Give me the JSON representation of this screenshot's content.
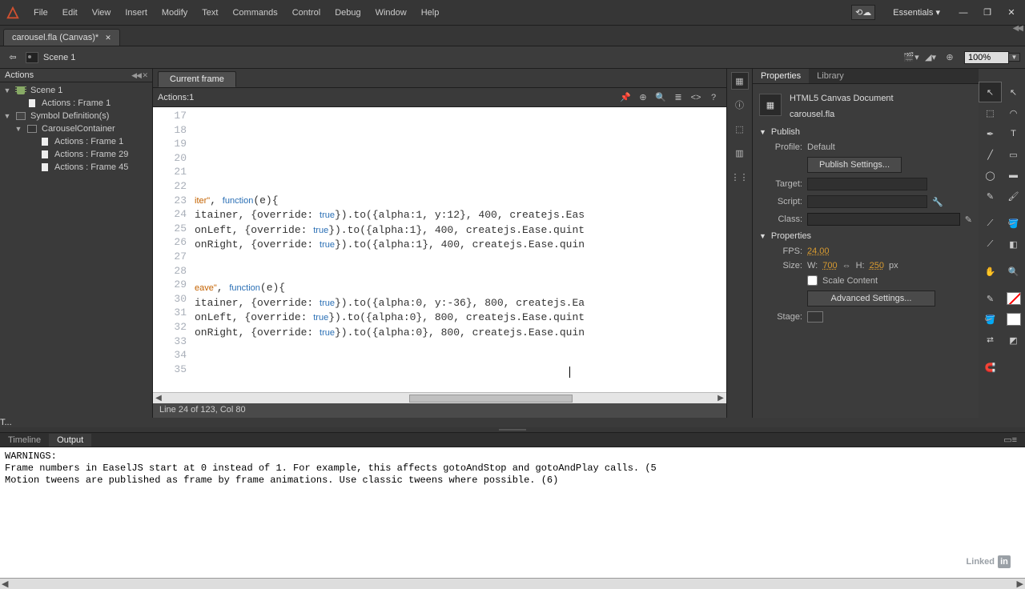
{
  "menu": {
    "items": [
      "File",
      "Edit",
      "View",
      "Insert",
      "Modify",
      "Text",
      "Commands",
      "Control",
      "Debug",
      "Window",
      "Help"
    ],
    "workspace": "Essentials"
  },
  "file_tab": {
    "name": "carousel.fla (Canvas)*"
  },
  "doc": {
    "scene": "Scene 1",
    "zoom": "100%"
  },
  "actions": {
    "panel": "Actions",
    "tree": {
      "scene": "Scene 1",
      "scene_actions": "Actions : Frame 1",
      "symdef": "Symbol Definition(s)",
      "container": "CarouselContainer",
      "frames": [
        "Actions : Frame 1",
        "Actions : Frame 29",
        "Actions : Frame 45"
      ]
    },
    "current_tab": "Current frame",
    "script_label": "Actions:1",
    "lines_start": 17,
    "code_lines": [
      "",
      "",
      "",
      "",
      "",
      "",
      {
        "pre": "",
        "str": "iter\"",
        "mid": ", ",
        "fn": "function",
        "post": "(e){",
        "fold": "open"
      },
      {
        "pre": "itainer, {override: ",
        "bool": "true",
        "post": "}).to({alpha:1, y:12}, 400, createjs.Eas"
      },
      {
        "pre": "onLeft, {override: ",
        "bool": "true",
        "post": "}).to({alpha:1}, 400, createjs.Ease.quint"
      },
      {
        "pre": "onRight, {override: ",
        "bool": "true",
        "post": "}).to({alpha:1}, 400, createjs.Ease.quin"
      },
      {
        "pre": "",
        "fold": "close"
      },
      "",
      {
        "pre": "",
        "str": "eave\"",
        "mid": ", ",
        "fn": "function",
        "post": "(e){",
        "fold": "open"
      },
      {
        "pre": "itainer, {override: ",
        "bool": "true",
        "post": "}).to({alpha:0, y:-36}, 800, createjs.Ea"
      },
      {
        "pre": "onLeft, {override: ",
        "bool": "true",
        "post": "}).to({alpha:0}, 800, createjs.Ease.quint"
      },
      {
        "pre": "onRight, {override: ",
        "bool": "true",
        "post": "}).to({alpha:0}, 800, createjs.Ease.quin"
      },
      "",
      "",
      ""
    ],
    "status": "Line 24 of 123, Col 80"
  },
  "props": {
    "tabs": [
      "Properties",
      "Library"
    ],
    "doc_type": "HTML5 Canvas Document",
    "filename": "carousel.fla",
    "publish": "Publish",
    "profile_lbl": "Profile:",
    "profile_val": "Default",
    "publish_btn": "Publish Settings...",
    "target": "Target:",
    "script": "Script:",
    "class": "Class:",
    "properties": "Properties",
    "fps_lbl": "FPS:",
    "fps": "24.00",
    "size_lbl": "Size:",
    "w_lbl": "W:",
    "w": "700",
    "h_lbl": "H:",
    "h": "250",
    "unit": "px",
    "scale": "Scale Content",
    "adv": "Advanced Settings...",
    "stage": "Stage:"
  },
  "toolbar_tab": "T...",
  "bottom": {
    "tabs": [
      "Timeline",
      "Output"
    ],
    "out": "WARNINGS:\nFrame numbers in EaselJS start at 0 instead of 1. For example, this affects gotoAndStop and gotoAndPlay calls. (5\nMotion tweens are published as frame by frame animations. Use classic tweens where possible. (6)"
  },
  "linkedin": "Linked"
}
